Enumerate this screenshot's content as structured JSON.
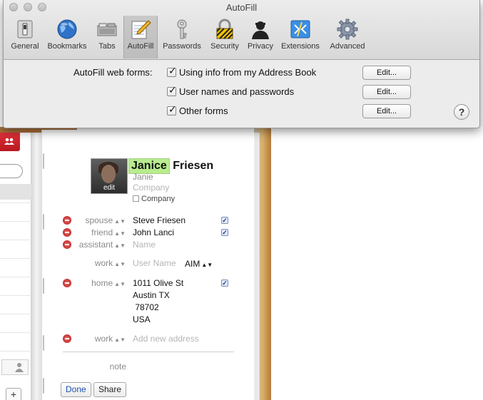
{
  "window": {
    "title": "AutoFill"
  },
  "toolbar": {
    "items": [
      {
        "label": "General",
        "icon": "switch-icon"
      },
      {
        "label": "Bookmarks",
        "icon": "globe-icon"
      },
      {
        "label": "Tabs",
        "icon": "tabs-icon"
      },
      {
        "label": "AutoFill",
        "icon": "pencil-notepad-icon",
        "selected": true
      },
      {
        "label": "Passwords",
        "icon": "key-icon"
      },
      {
        "label": "Security",
        "icon": "padlock-icon"
      },
      {
        "label": "Privacy",
        "icon": "silhouette-icon"
      },
      {
        "label": "Extensions",
        "icon": "puzzle-icon"
      },
      {
        "label": "Advanced",
        "icon": "gear-icon"
      }
    ]
  },
  "autofill": {
    "label": "AutoFill web forms:",
    "options": [
      {
        "label": "Using info from my Address Book",
        "checked": true,
        "button": "Edit..."
      },
      {
        "label": "User names and passwords",
        "checked": true,
        "button": "Edit..."
      },
      {
        "label": "Other forms",
        "checked": true,
        "button": "Edit..."
      }
    ],
    "help": "?"
  },
  "card": {
    "photo_edit": "edit",
    "first_name": "Janice",
    "last_name": "Friesen",
    "nickname": "Janie",
    "company_placeholder": "Company",
    "company_checkbox": "Company",
    "rows": [
      {
        "label": "spouse",
        "value": "Steve Friesen",
        "placeholder": false,
        "checked": true
      },
      {
        "label": "friend",
        "value": "John Lanci",
        "placeholder": false,
        "checked": true
      },
      {
        "label": "assistant",
        "value": "Name",
        "placeholder": true,
        "checked": false
      }
    ],
    "im": {
      "label": "work",
      "placeholder": "User Name",
      "service": "AIM"
    },
    "address": {
      "label": "home",
      "lines": [
        "1011 Olive St",
        "Austin TX",
        " 78702",
        "USA"
      ],
      "checked": true
    },
    "new_address": {
      "label": "work",
      "placeholder": "Add new address"
    },
    "note": {
      "label": "note"
    },
    "buttons": {
      "done": "Done",
      "share": "Share"
    },
    "add_button": "+"
  }
}
